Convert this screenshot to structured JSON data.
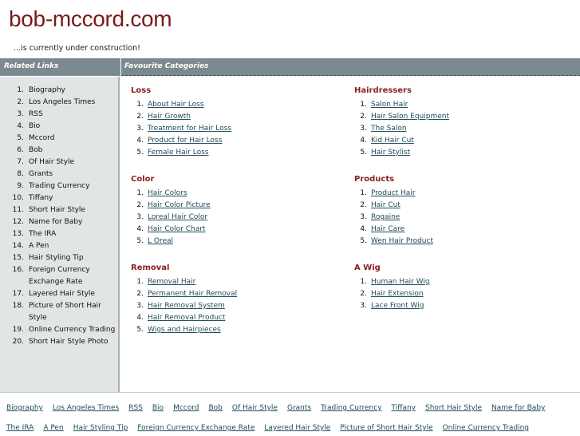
{
  "header": {
    "site_title": "bob-mccord.com",
    "tagline": "...is currently under construction!"
  },
  "sidebar": {
    "heading": "Related Links",
    "items": [
      {
        "num": "1.",
        "label": "Biography"
      },
      {
        "num": "2.",
        "label": "Los Angeles Times"
      },
      {
        "num": "3.",
        "label": "RSS"
      },
      {
        "num": "4.",
        "label": "Bio"
      },
      {
        "num": "5.",
        "label": "Mccord"
      },
      {
        "num": "6.",
        "label": "Bob"
      },
      {
        "num": "7.",
        "label": "Of Hair Style"
      },
      {
        "num": "8.",
        "label": "Grants"
      },
      {
        "num": "9.",
        "label": "Trading Currency"
      },
      {
        "num": "10.",
        "label": "Tiffany"
      },
      {
        "num": "11.",
        "label": "Short Hair Style"
      },
      {
        "num": "12.",
        "label": "Name for Baby"
      },
      {
        "num": "13.",
        "label": "The IRA"
      },
      {
        "num": "14.",
        "label": "A Pen"
      },
      {
        "num": "15.",
        "label": "Hair Styling Tip"
      },
      {
        "num": "16.",
        "label": "Foreign Currency Exchange Rate"
      },
      {
        "num": "17.",
        "label": "Layered Hair Style"
      },
      {
        "num": "18.",
        "label": "Picture of Short Hair Style"
      },
      {
        "num": "19.",
        "label": "Online Currency Trading"
      },
      {
        "num": "20.",
        "label": "Short Hair Style Photo"
      }
    ]
  },
  "main": {
    "heading": "Favourite Categories",
    "categories": [
      {
        "title": "Loss",
        "links": [
          {
            "num": "1.",
            "label": "About Hair Loss"
          },
          {
            "num": "2.",
            "label": "Hair Growth"
          },
          {
            "num": "3.",
            "label": "Treatment for Hair Loss"
          },
          {
            "num": "4.",
            "label": "Product for Hair Loss"
          },
          {
            "num": "5.",
            "label": "Female Hair Loss"
          }
        ]
      },
      {
        "title": "Hairdressers",
        "links": [
          {
            "num": "1.",
            "label": "Salon Hair"
          },
          {
            "num": "2.",
            "label": "Hair Salon Equipment"
          },
          {
            "num": "3.",
            "label": "The Salon"
          },
          {
            "num": "4.",
            "label": "Kid Hair Cut"
          },
          {
            "num": "5.",
            "label": "Hair Stylist"
          }
        ]
      },
      {
        "title": "Color",
        "links": [
          {
            "num": "1.",
            "label": "Hair Colors"
          },
          {
            "num": "2.",
            "label": "Hair Color Picture"
          },
          {
            "num": "3.",
            "label": "Loreal Hair Color"
          },
          {
            "num": "4.",
            "label": "Hair Color Chart"
          },
          {
            "num": "5.",
            "label": "L Oreal"
          }
        ]
      },
      {
        "title": "Products",
        "links": [
          {
            "num": "1.",
            "label": "Product Hair"
          },
          {
            "num": "2.",
            "label": "Hair Cut"
          },
          {
            "num": "3.",
            "label": "Rogaine"
          },
          {
            "num": "4.",
            "label": "Hair Care"
          },
          {
            "num": "5.",
            "label": "Wen Hair Product"
          }
        ]
      },
      {
        "title": "Removal",
        "links": [
          {
            "num": "1.",
            "label": "Removal Hair"
          },
          {
            "num": "2.",
            "label": "Permanent Hair Removal"
          },
          {
            "num": "3.",
            "label": "Hair Removal System"
          },
          {
            "num": "4.",
            "label": "Hair Removal Product"
          },
          {
            "num": "5.",
            "label": "Wigs and Hairpieces"
          }
        ]
      },
      {
        "title": "A Wig",
        "links": [
          {
            "num": "1.",
            "label": "Human Hair Wig"
          },
          {
            "num": "2.",
            "label": "Hair Extension"
          },
          {
            "num": "3.",
            "label": "Lace Front Wig"
          }
        ]
      }
    ]
  },
  "footer": {
    "links": [
      "Biography",
      "Los Angeles Times",
      "RSS",
      "Bio",
      "Mccord",
      "Bob",
      "Of Hair Style",
      "Grants",
      "Trading Currency",
      "Tiffany",
      "Short Hair Style",
      "Name for Baby",
      "The IRA",
      "A Pen",
      "Hair Styling Tip",
      "Foreign Currency Exchange Rate",
      "Layered Hair Style",
      "Picture of Short Hair Style",
      "Online Currency Trading",
      "Short Hair Style Photo"
    ]
  },
  "colors": {
    "title": "#7a1a1a",
    "bar": "#7b8a8f",
    "sidebar_bg": "#e2e5e5",
    "category_title": "#8a2020",
    "link": "#1f4a5a"
  }
}
